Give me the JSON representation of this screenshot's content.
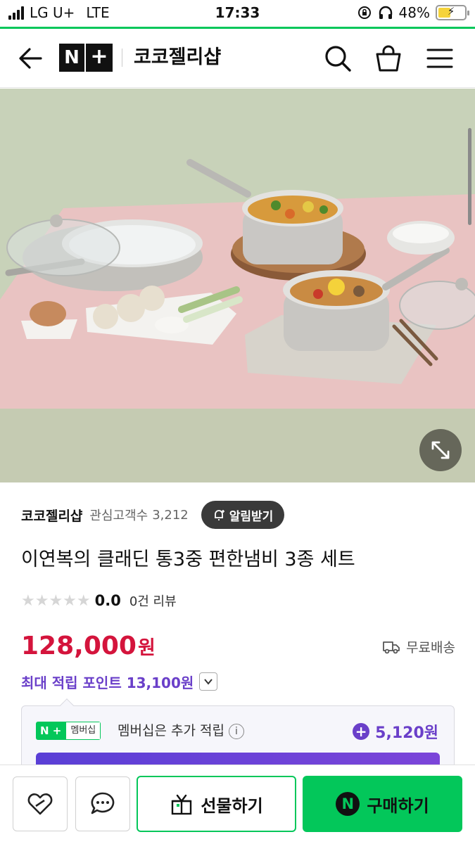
{
  "status_bar": {
    "carrier": "LG U+",
    "network": "LTE",
    "time": "17:33",
    "battery_percent": "48%",
    "battery_level": 0.48,
    "battery_color": "#f5d33a"
  },
  "header": {
    "logo_n": "N",
    "logo_plus": "+",
    "store_name": "코코젤리샵"
  },
  "seller": {
    "name": "코코젤리샵",
    "follow_label": "관심고객수",
    "follow_count": "3,212",
    "alarm_label": "알림받기"
  },
  "product": {
    "title": "이연복의 클래딘 통3중 편한냄비 3종 세트",
    "stars": "★★★★★",
    "rating": "0.0",
    "review_count": "0건 리뷰",
    "price": "128,000",
    "price_unit": "원",
    "shipping": "무료배송",
    "max_points": "최대 적립 포인트 13,100원"
  },
  "membership": {
    "badge_np": "N +",
    "badge_label": "멤버십",
    "text": "멤버십은 추가 적립",
    "info": "i",
    "points": "5,120원"
  },
  "bottom_bar": {
    "gift_label": "선물하기",
    "buy_label": "구매하기",
    "npay_letter": "N"
  },
  "colors": {
    "accent_green": "#03c75a",
    "price_red": "#d4143c",
    "points_purple": "#6a3fc9"
  }
}
